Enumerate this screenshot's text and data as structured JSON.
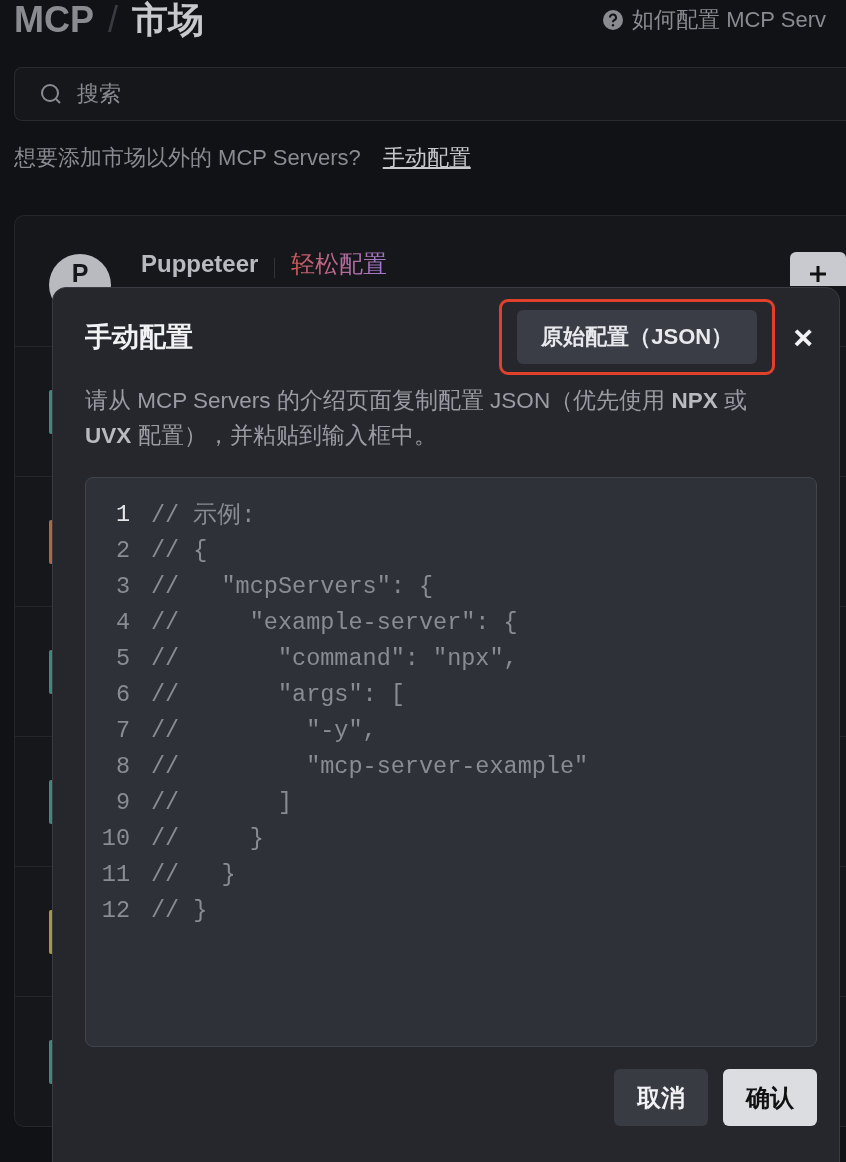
{
  "header": {
    "title": "MCP",
    "separator": "/",
    "subtitle": "市场",
    "help_link": "如何配置 MCP Serv"
  },
  "search": {
    "placeholder": "搜索"
  },
  "hint": {
    "text": "想要添加市场以外的 MCP Servers?",
    "link": "手动配置"
  },
  "servers": [
    {
      "avatar": "P",
      "name": "Puppeteer",
      "tag": "轻松配置"
    }
  ],
  "more_rows": [
    {
      "color": "#3d8a7c"
    },
    {
      "color": "#b0683e"
    },
    {
      "color": "#3d8a7c"
    },
    {
      "color": "#3d8a7c"
    },
    {
      "color": "#a39a3e"
    },
    {
      "color": "#3d8a7c"
    }
  ],
  "dialog": {
    "title": "手动配置",
    "mode_button": "原始配置（JSON）",
    "mode_highlighted": true,
    "close": "×",
    "description": "请从 MCP Servers 的介绍页面复制配置 JSON（优先使用 **NPX** 或 **UVX** 配置），并粘贴到输入框中。",
    "editor_lines": [
      {
        "number": "1",
        "code": "// 示例:",
        "active": true
      },
      {
        "number": "2",
        "code": "// {",
        "active": false
      },
      {
        "number": "3",
        "code": "//   \"mcpServers\": {",
        "active": false
      },
      {
        "number": "4",
        "code": "//     \"example-server\": {",
        "active": false
      },
      {
        "number": "5",
        "code": "//       \"command\": \"npx\",",
        "active": false
      },
      {
        "number": "6",
        "code": "//       \"args\": [",
        "active": false
      },
      {
        "number": "7",
        "code": "//         \"-y\",",
        "active": false
      },
      {
        "number": "8",
        "code": "//         \"mcp-server-example\"",
        "active": false
      },
      {
        "number": "9",
        "code": "//       ]",
        "active": false
      },
      {
        "number": "10",
        "code": "//     }",
        "active": false
      },
      {
        "number": "11",
        "code": "//   }",
        "active": false
      },
      {
        "number": "12",
        "code": "// }",
        "active": false
      }
    ],
    "buttons": [
      {
        "label": "取消",
        "kind": "secondary"
      },
      {
        "label": "确认",
        "kind": "primary"
      }
    ]
  }
}
